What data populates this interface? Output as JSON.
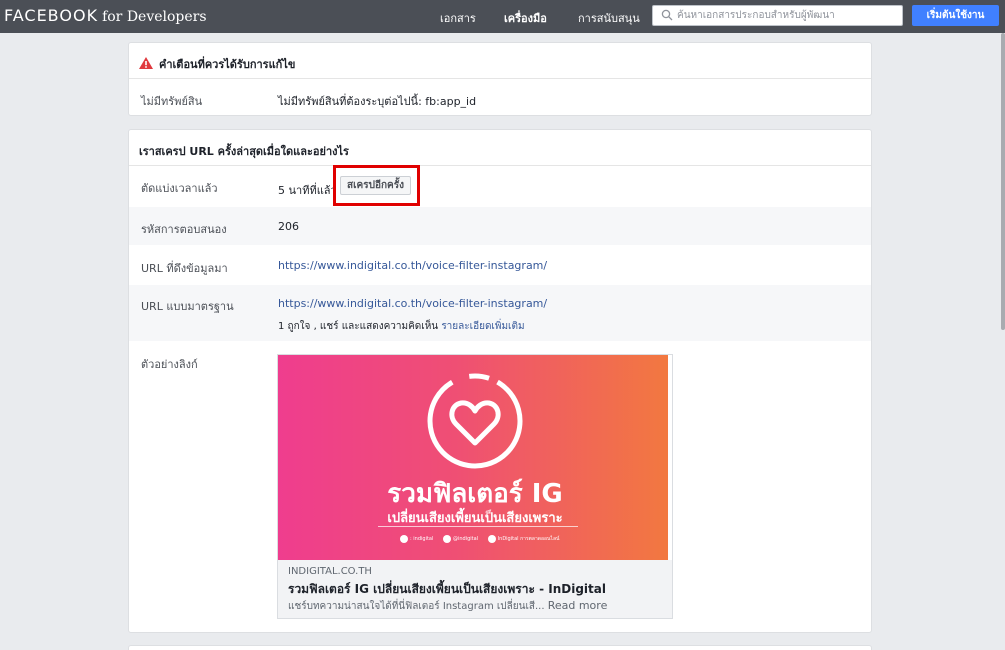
{
  "header": {
    "brand_main": "FACEBOOK",
    "brand_sub": "for Developers",
    "nav": [
      "เอกสาร",
      "เครื่องมือ",
      "การสนับสนุน"
    ],
    "search_placeholder": "ค้นหาเอกสารประกอบสำหรับผู้พัฒนา",
    "start_button": "เริ่มต้นใช้งาน"
  },
  "warnings": {
    "title": "คำเตือนที่ควรได้รับการแก้ไข",
    "rows": [
      {
        "label": "ไม่มีทรัพย์สิน",
        "value": "ไม่มีทรัพย์สินที่ต้องระบุต่อไปนี้: fb:app_id"
      }
    ]
  },
  "scrape": {
    "title": "เราสเครป URL ครั้งล่าสุดเมื่อใดและอย่างไร",
    "time_label": "ตัดแบ่งเวลาแล้ว",
    "time_value": "5 นาทีที่แล้ว",
    "rescrape_button": "สเครปอีกครั้ง",
    "response_label": "รหัสการตอบสนอง",
    "response_value": "206",
    "fetched_label": "URL ที่ดึงข้อมูลมา",
    "fetched_url": "https://www.indigital.co.th/voice-filter-instagram/",
    "canonical_label": "URL แบบมาตรฐาน",
    "canonical_url": "https://www.indigital.co.th/voice-filter-instagram/",
    "engagement_text": "1 ถูกใจ , แชร์ และแสดงความคิดเห็น",
    "more_details": "รายละเอียดเพิ่มเติม",
    "preview_label": "ตัวอย่างลิงก์"
  },
  "preview": {
    "headline": "รวมฟิลเตอร์ IG",
    "subheadline": "เปลี่ยนเสียงเพี้ยนเป็นเสียงเพราะ",
    "socials": [
      ": indigital",
      "@indigital",
      "InDigital การตลาดออนไลน์"
    ],
    "domain": "INDIGITAL.CO.TH",
    "title": "รวมฟิลเตอร์ IG เปลี่ยนเสียงเพี้ยนเป็นเสียงเพราะ - InDigital",
    "description": "แชร์บทความน่าสนใจได้ที่นี่ฟิลเตอร์ Instagram เปลี่ยนเสี...",
    "read_more": "Read more"
  },
  "colors": {
    "topbar": "#4b4f56",
    "primary": "#4080ff",
    "link": "#365899",
    "highlight": "#e00000"
  }
}
